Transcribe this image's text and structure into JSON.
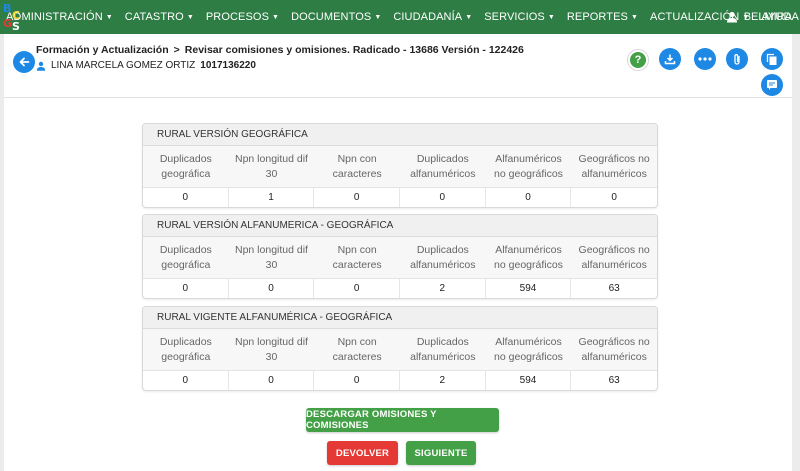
{
  "logo": {
    "letters": [
      "B",
      "C",
      "G",
      "S"
    ]
  },
  "nav": {
    "items": [
      {
        "label": "ADMINISTRACIÓN"
      },
      {
        "label": "CATASTRO"
      },
      {
        "label": "PROCESOS"
      },
      {
        "label": "DOCUMENTOS"
      },
      {
        "label": "CIUDADANÍA"
      },
      {
        "label": "SERVICIOS"
      },
      {
        "label": "REPORTES"
      },
      {
        "label": "ACTUALIZACIÓN"
      },
      {
        "label": "AYUDA"
      }
    ],
    "user": "BELMIRA"
  },
  "header": {
    "breadcrumb_root": "Formación y Actualización",
    "breadcrumb_separator": ">",
    "breadcrumb_current": "Revisar comisiones y omisiones. Radicado - 13686 Versión - 122426",
    "person_name": "LINA MARCELA GOMEZ ORTIZ",
    "person_id": "1017136220"
  },
  "columns": [
    "Duplicados geográfica",
    "Npn longitud dif 30",
    "Npn con caracteres",
    "Duplicados alfanuméricos",
    "Alfanuméricos no geográficos",
    "Geográficos no alfanuméricos"
  ],
  "panels": [
    {
      "title": "RURAL VERSIÓN GEOGRÁFICA",
      "values": [
        "0",
        "1",
        "0",
        "0",
        "0",
        "0"
      ]
    },
    {
      "title": "RURAL VERSIÓN ALFANUMERICA - GEOGRÁFICA",
      "values": [
        "0",
        "0",
        "0",
        "2",
        "594",
        "63"
      ]
    },
    {
      "title": "RURAL VIGENTE ALFANUMÉRICA - GEOGRÁFICA",
      "values": [
        "0",
        "0",
        "0",
        "2",
        "594",
        "63"
      ]
    }
  ],
  "buttons": {
    "download": "DESCARGAR OMISIONES Y COMISIONES",
    "return": "DEVOLVER",
    "next": "SIGUIENTE"
  },
  "colors": {
    "nav": "#2e7d45",
    "primary": "#1e88e5",
    "success": "#43a047",
    "danger": "#e53935"
  },
  "icons": [
    "help-icon",
    "download-icon",
    "more-icon",
    "attachment-icon",
    "copy-icon",
    "notes-icon"
  ]
}
